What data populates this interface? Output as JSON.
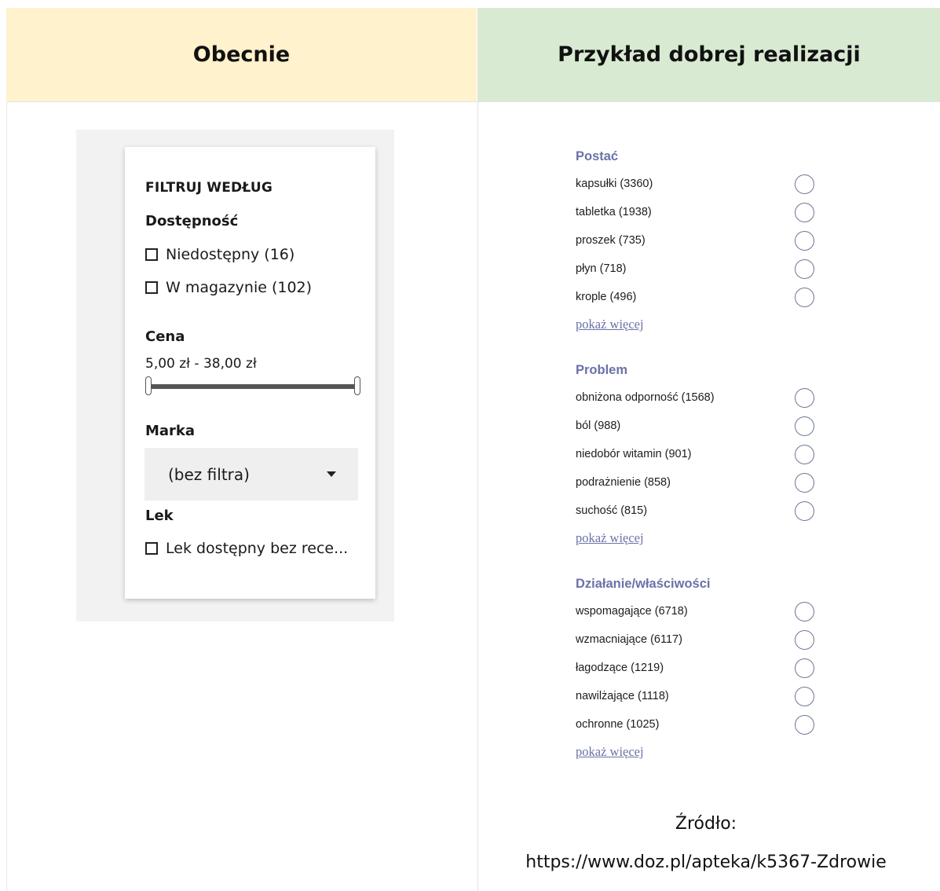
{
  "headers": {
    "current": "Obecnie",
    "good_example": "Przykład dobrej realizacji"
  },
  "current_filter": {
    "title": "FILTRUJ WEDŁUG",
    "availability": {
      "label": "Dostępność",
      "options": [
        "Niedostępny (16)",
        "W magazynie (102)"
      ]
    },
    "price": {
      "label": "Cena",
      "range": "5,00 zł - 38,00 zł"
    },
    "brand": {
      "label": "Marka",
      "selected": "(bez filtra)"
    },
    "drug": {
      "label": "Lek",
      "option": "Lek dostępny bez rece..."
    }
  },
  "example_filter": {
    "show_more": "pokaż więcej",
    "groups": [
      {
        "title": "Postać",
        "items": [
          "kapsułki (3360)",
          "tabletka (1938)",
          "proszek (735)",
          "płyn (718)",
          "krople (496)"
        ]
      },
      {
        "title": "Problem",
        "items": [
          "obniżona odporność (1568)",
          "ból (988)",
          "niedobór witamin (901)",
          "podrażnienie (858)",
          "suchość (815)"
        ]
      },
      {
        "title": "Działanie/właściwości",
        "items": [
          "wspomagające (6718)",
          "wzmacniające (6117)",
          "łagodzące (1219)",
          "nawilżające (1118)",
          "ochronne (1025)"
        ]
      }
    ]
  },
  "source": {
    "label": "Źródło:",
    "url": "https://www.doz.pl/apteka/k5367-Zdrowie"
  }
}
